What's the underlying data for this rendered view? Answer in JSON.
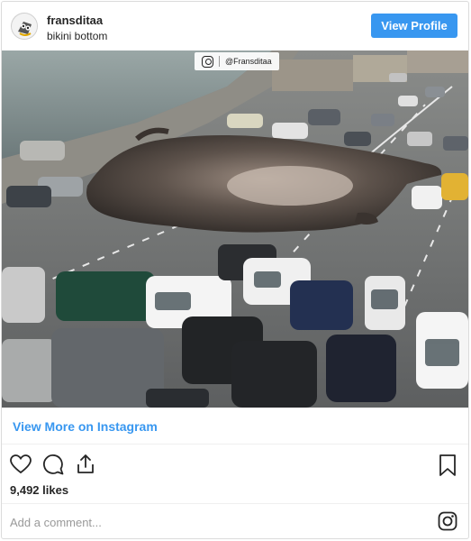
{
  "header": {
    "username": "fransditaa",
    "location": "bikini bottom",
    "view_profile_label": "View Profile"
  },
  "photo": {
    "watermark_handle": "@Fransditaa"
  },
  "footer": {
    "view_more_label": "View More on Instagram",
    "likes_text": "9,492 likes",
    "comment_placeholder": "Add a comment..."
  },
  "colors": {
    "accent": "#3897f0",
    "text": "#262626",
    "muted": "#999999",
    "border": "#dbdbdb"
  },
  "icons": [
    "avatar-icon",
    "heart-icon",
    "comment-icon",
    "share-icon",
    "bookmark-icon",
    "instagram-logo-icon"
  ]
}
